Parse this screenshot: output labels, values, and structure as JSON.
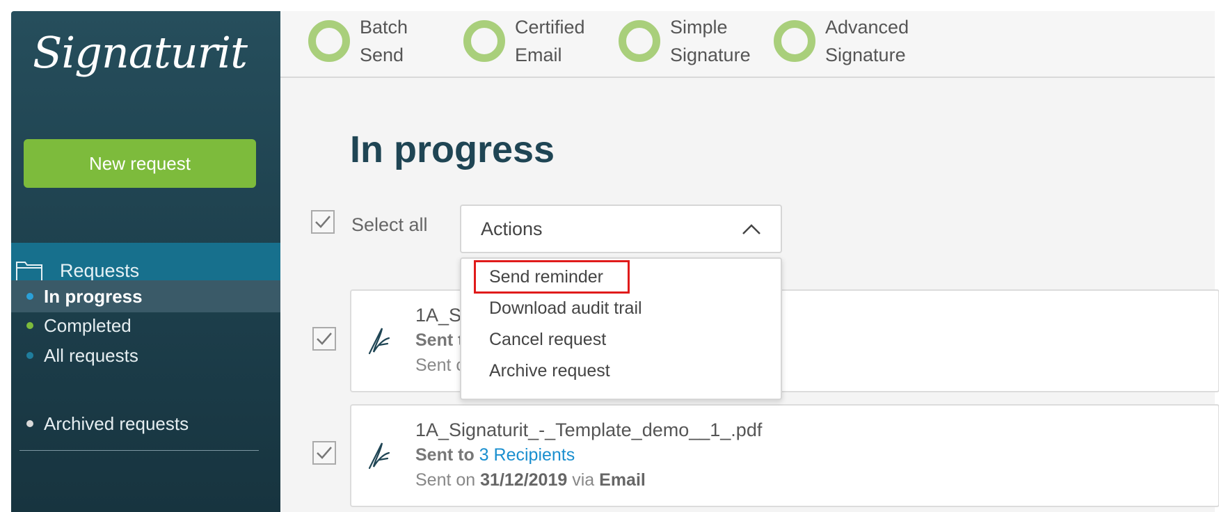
{
  "sidebar": {
    "logo_text": "Signaturit",
    "new_request_label": "New request",
    "requests_label": "Requests",
    "items": [
      {
        "label": "In progress",
        "dot_color": "#2aa0d8",
        "active": true
      },
      {
        "label": "Completed",
        "dot_color": "#7dbb3c",
        "active": false
      },
      {
        "label": "All requests",
        "dot_color": "#1f7d9c",
        "active": false
      }
    ],
    "archived_label": "Archived requests",
    "archived_dot_color": "#d9d9d9"
  },
  "topbar": {
    "products": [
      {
        "line1": "Batch",
        "line2": "Send"
      },
      {
        "line1": "Certified",
        "line2": "Email"
      },
      {
        "line1": "Simple",
        "line2": "Signature"
      },
      {
        "line1": "Advanced",
        "line2": "Signature"
      }
    ]
  },
  "main": {
    "title": "In progress",
    "select_all_label": "Select all",
    "actions_label": "Actions",
    "actions_menu": [
      "Send reminder",
      "Download audit trail",
      "Cancel request",
      "Archive request"
    ],
    "cards": [
      {
        "filename": "1A_S",
        "sent_to_label": "Sent t",
        "sent_on_prefix": "Sent c"
      },
      {
        "filename": "1A_Signaturit_-_Template_demo__1_.pdf",
        "sent_to_label": "Sent to",
        "recipients": "3 Recipients",
        "sent_on_prefix": "Sent on",
        "date": "31/12/2019",
        "via": "via",
        "channel": "Email"
      }
    ]
  },
  "colors": {
    "sidebar_bg": "#1d3f4c",
    "accent_green": "#7dbb3c",
    "requests_blue": "#17708d",
    "link_blue": "#1a8fcf",
    "highlight_red": "#e01b1b"
  }
}
